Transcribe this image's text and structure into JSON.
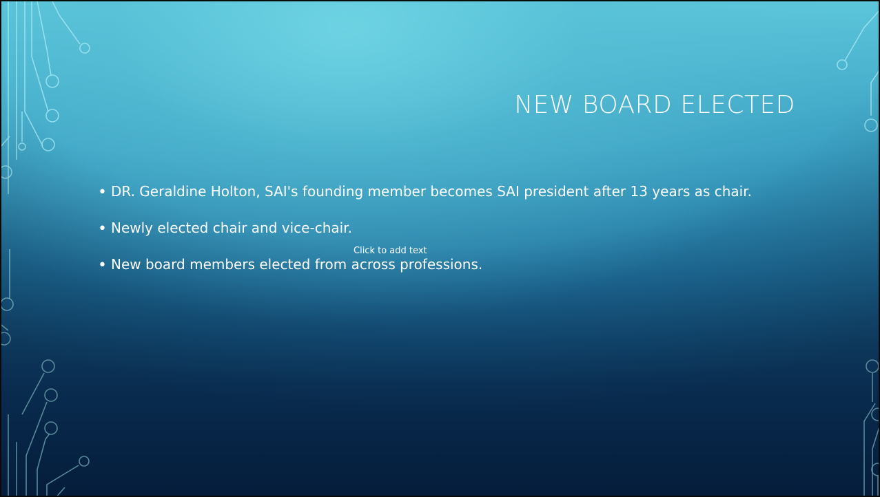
{
  "slide": {
    "title": "NEW BOARD ELECTED",
    "bullets": [
      "DR. Geraldine Holton, SAI's founding member becomes SAI president after 13 years as chair.",
      "Newly elected chair and vice-chair.",
      "New board members elected from across professions."
    ],
    "placeholder": "Click to add text",
    "bullet_glyph": "•"
  },
  "colors": {
    "text": "#ffffff",
    "circuit_line": "#9fe6f2",
    "background_top": "#5cc6db",
    "background_bottom": "#07264a"
  }
}
